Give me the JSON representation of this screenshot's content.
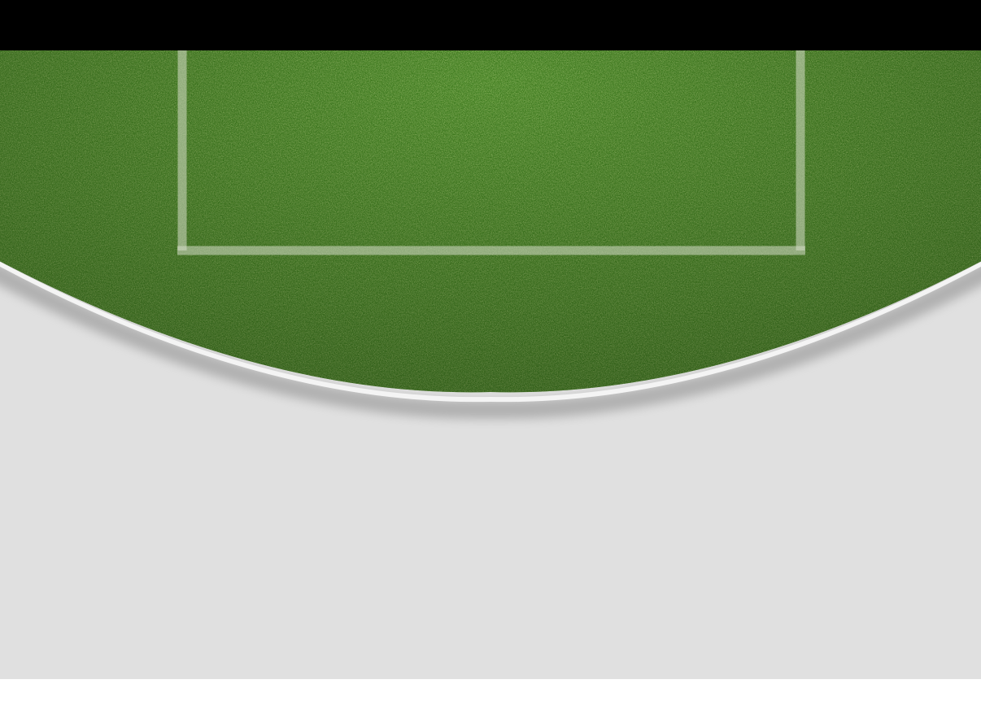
{
  "scene": {
    "name": "football-pitch-view",
    "colors": {
      "top_bar": "#000000",
      "grass_base": "#3d7a1e",
      "grass_dark": "#2c5e14",
      "grass_light": "#5a9a2c",
      "pitch_lines": "#cfd8c0",
      "background": "#e0e0e0",
      "bottom_strip": "#ffffff"
    },
    "icons": [
      "penalty-box-lines"
    ]
  }
}
